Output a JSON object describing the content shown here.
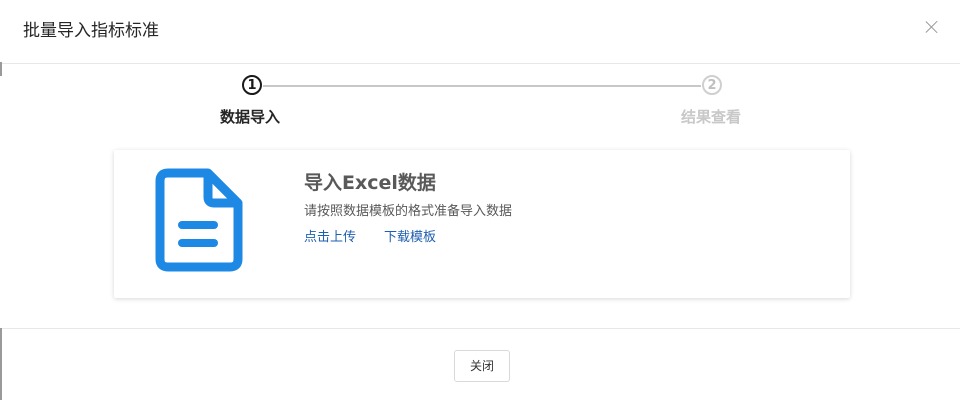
{
  "dialog": {
    "title": "批量导入指标标准",
    "close_icon": "close-icon"
  },
  "steps": [
    {
      "number": "1",
      "label": "数据导入",
      "state": "active",
      "color": "#1a1a1a"
    },
    {
      "number": "2",
      "label": "结果查看",
      "state": "pending",
      "color": "#c8c8c8"
    }
  ],
  "card": {
    "icon": "document-icon",
    "icon_color": "#1e88e5",
    "title": "导入Excel数据",
    "description": "请按照数据模板的格式准备导入数据",
    "upload_link": "点击上传",
    "download_link": "下载模板",
    "link_color": "#1f5fb0"
  },
  "footer": {
    "close_label": "关闭"
  }
}
